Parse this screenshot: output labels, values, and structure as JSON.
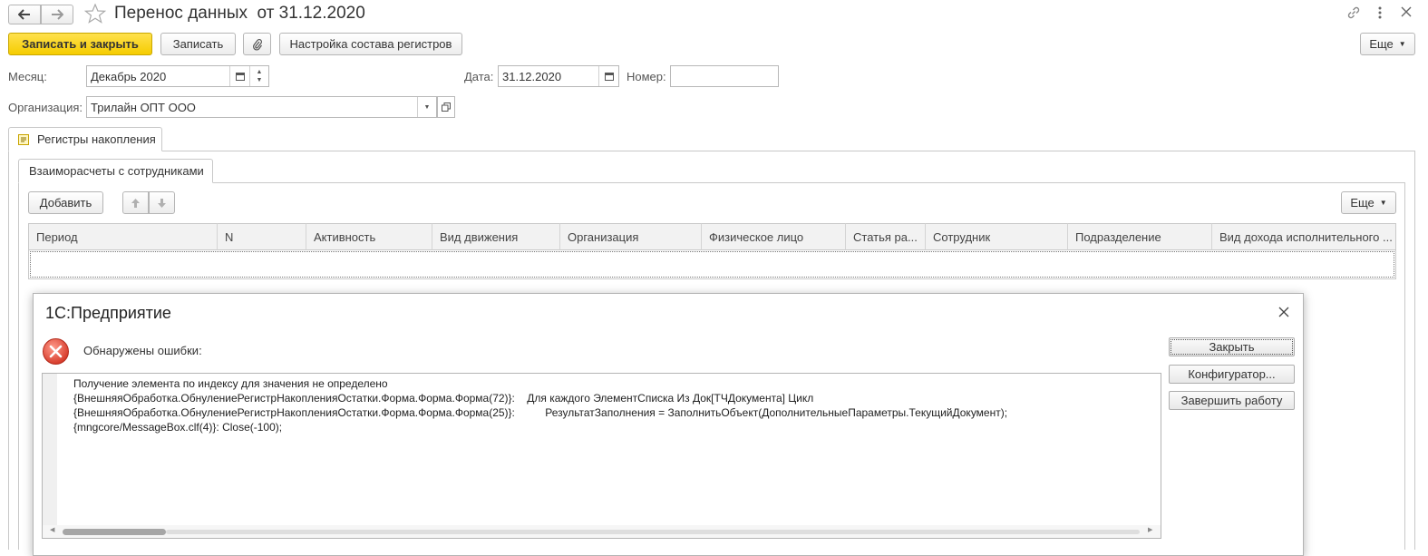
{
  "window": {
    "title": "Перенос данных  от 31.12.2020"
  },
  "toolbar": {
    "save_close_label": "Записать и закрыть",
    "save_label": "Записать",
    "registers_settings_label": "Настройка состава регистров",
    "more_label": "Еще"
  },
  "form": {
    "month_label": "Месяц:",
    "month_value": "Декабрь 2020",
    "date_label": "Дата:",
    "date_value": "31.12.2020",
    "number_label": "Номер:",
    "number_value": "",
    "org_label": "Организация:",
    "org_value": "Трилайн ОПТ ООО"
  },
  "tabs": {
    "main_tab": "Регистры накопления",
    "sub_tab": "Взаиморасчеты с сотрудниками"
  },
  "table_toolbar": {
    "add_label": "Добавить",
    "more_label": "Еще"
  },
  "table": {
    "columns": [
      "Период",
      "N",
      "Активность",
      "Вид движения",
      "Организация",
      "Физическое лицо",
      "Статья ра...",
      "Сотрудник",
      "Подразделение",
      "Вид дохода исполнительного ..."
    ]
  },
  "dialog": {
    "title": "1С:Предприятие",
    "header": "Обнаружены ошибки:",
    "close_label": "Закрыть",
    "configurator_label": "Конфигуратор...",
    "terminate_label": "Завершить работу",
    "message_lines": [
      "Получение элемента по индексу для значения не определено",
      "{ВнешняяОбработка.ОбнулениеРегистрНакопленияОстатки.Форма.Форма.Форма(72)}:    Для каждого ЭлементСписка Из Док[ТЧДокумента] Цикл",
      "{ВнешняяОбработка.ОбнулениеРегистрНакопленияОстатки.Форма.Форма.Форма(25)}:          РезультатЗаполнения = ЗаполнитьОбъект(ДополнительныеПараметры.ТекущийДокумент);",
      "{mngcore/MessageBox.clf(4)}: Close(-100);"
    ]
  },
  "colors": {
    "accent": "#f5cc00",
    "error": "#e04a3a"
  }
}
